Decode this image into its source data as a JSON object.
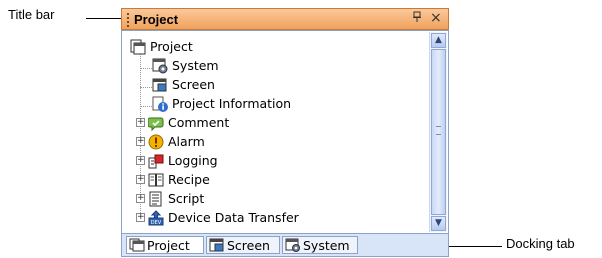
{
  "callouts": {
    "title_bar": "Title bar",
    "docking_tab": "Docking tab"
  },
  "window": {
    "title": "Project",
    "pin_glyph": "ф",
    "close_glyph": "×"
  },
  "tree": {
    "root": {
      "label": "Project",
      "icon": "project-icon"
    },
    "children": [
      {
        "label": "System",
        "icon": "system-icon",
        "expandable": false
      },
      {
        "label": "Screen",
        "icon": "screen-icon",
        "expandable": false
      },
      {
        "label": "Project Information",
        "icon": "info-icon",
        "expandable": false
      },
      {
        "label": "Comment",
        "icon": "comment-icon",
        "expandable": true
      },
      {
        "label": "Alarm",
        "icon": "alarm-icon",
        "expandable": true
      },
      {
        "label": "Logging",
        "icon": "logging-icon",
        "expandable": true
      },
      {
        "label": "Recipe",
        "icon": "recipe-icon",
        "expandable": true
      },
      {
        "label": "Script",
        "icon": "script-icon",
        "expandable": true
      },
      {
        "label": "Device Data Transfer",
        "icon": "device-data-transfer-icon",
        "expandable": true
      }
    ]
  },
  "tabs": [
    {
      "label": "Project",
      "icon": "project-icon",
      "active": true
    },
    {
      "label": "Screen",
      "icon": "screen-icon",
      "active": false
    },
    {
      "label": "System",
      "icon": "system-icon",
      "active": false
    }
  ],
  "colors": {
    "title_bar": "#f0a25c",
    "tab_bar": "#d8e4f8",
    "border": "#8da2c6"
  }
}
